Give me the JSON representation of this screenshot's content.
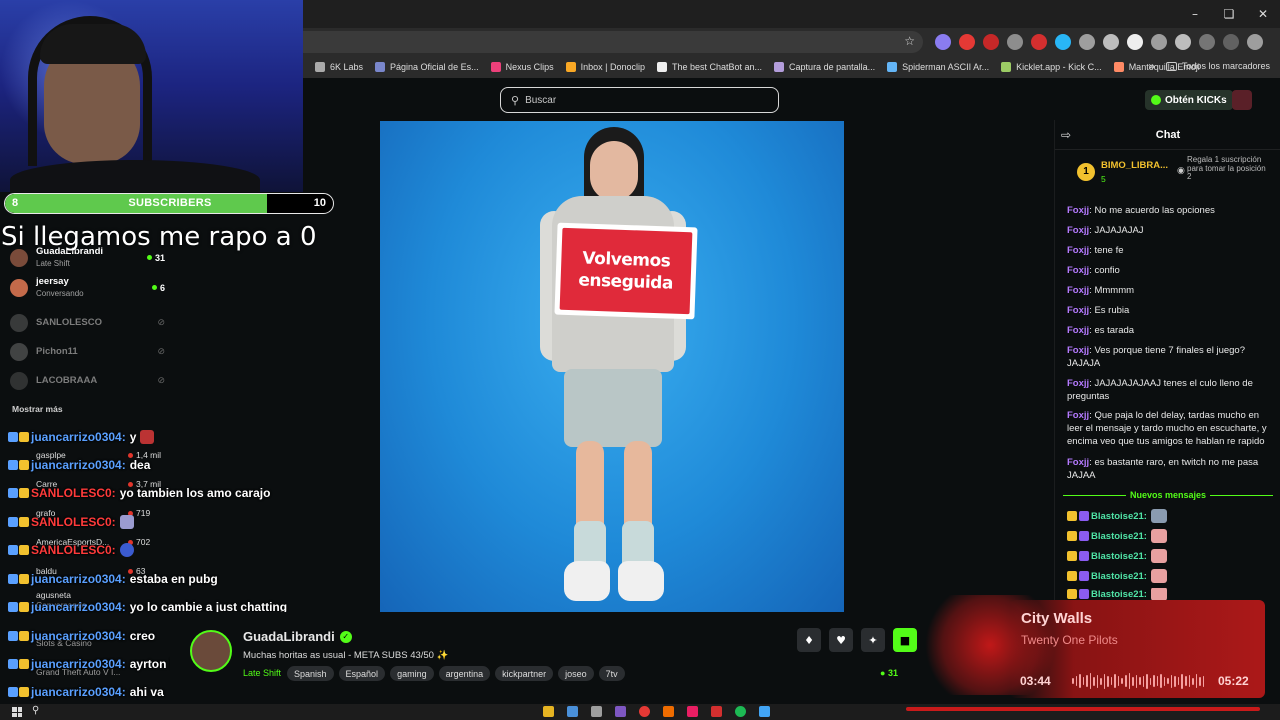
{
  "bookmarks": {
    "items": [
      "6K Labs",
      "Página Oficial de Es...",
      "Nexus Clips",
      "Inbox | Donoclip",
      "The best ChatBot an...",
      "Captura de pantalla...",
      "Spiderman ASCII Ar...",
      "Kicklet.app - Kick C...",
      "Mantequilla Emoji"
    ],
    "all_label": "Todos los marcadores"
  },
  "header": {
    "search_placeholder": "Buscar",
    "get_kicks_label": "Obtén KICKs"
  },
  "overlay": {
    "goal_current": "8",
    "goal_label": "SUBSCRIBERS",
    "goal_target": "10",
    "goal_progress": 0.8,
    "caption": "Si llegamos me rapo a 0"
  },
  "sidebar": {
    "following": [
      {
        "name": "GuadaLibrandi",
        "sub": "Late Shift",
        "count": "31",
        "live": true,
        "color": "#7a4b3a"
      },
      {
        "name": "jeersay",
        "sub": "Conversando",
        "count": "6",
        "live": true,
        "color": "#c46a4a"
      },
      {
        "name": "SANLOLESCO",
        "sub": "",
        "count": "",
        "live": false,
        "color": "#666"
      },
      {
        "name": "Pichon11",
        "sub": "",
        "count": "",
        "live": false,
        "color": "#777"
      },
      {
        "name": "LACOBRAAA",
        "sub": "",
        "count": "",
        "live": false,
        "color": "#555"
      }
    ],
    "show_more": "Mostrar más"
  },
  "recommended": [
    {
      "name": "gasplpe",
      "viewers": "1,4 mil"
    },
    {
      "name": "Carre",
      "viewers": "3,7 mil"
    },
    {
      "name": "grafo",
      "viewers": "719"
    },
    {
      "name": "AmericaEsportsD...",
      "viewers": "702"
    },
    {
      "name": "baldu",
      "viewers": "63"
    },
    {
      "name": "agusneta",
      "sub": "Conversando",
      "viewers": ""
    },
    {
      "name": "",
      "sub": "Slots & Casino",
      "viewers": ""
    },
    {
      "name": "",
      "sub": "Grand Theft Auto V I...",
      "viewers": ""
    }
  ],
  "overlay_chat": [
    {
      "user": "juancarrizo0304:",
      "msg": "y",
      "color": "#5aa0ff",
      "emote": true
    },
    {
      "user": "juancarrizo0304:",
      "msg": "dea",
      "color": "#5aa0ff",
      "emote": false
    },
    {
      "user": "SANLOLESC0:",
      "msg": "yo tambien los amo carajo",
      "color": "#ff3b3b",
      "emote": false
    },
    {
      "user": "SANLOLESC0:",
      "msg": "",
      "color": "#ff3b3b",
      "emote": true
    },
    {
      "user": "SANLOLESC0:",
      "msg": "",
      "color": "#ff3b3b",
      "emote": true
    },
    {
      "user": "juancarrizo0304:",
      "msg": "estaba en pubg",
      "color": "#5aa0ff",
      "emote": false
    },
    {
      "user": "juancarrizo0304:",
      "msg": "yo lo cambie a just chatting",
      "color": "#5aa0ff",
      "emote": false
    },
    {
      "user": "juancarrizo0304:",
      "msg": "creo",
      "color": "#5aa0ff",
      "emote": false
    },
    {
      "user": "juancarrizo0304:",
      "msg": "ayrton lo cambio a pubg",
      "color": "#5aa0ff",
      "emote": false
    },
    {
      "user": "juancarrizo0304:",
      "msg": "ahi va",
      "color": "#5aa0ff",
      "emote": false
    }
  ],
  "video": {
    "sign_line1": "Volvemos",
    "sign_line2": "enseguida"
  },
  "stream": {
    "name": "GuadaLibrandi",
    "title": "Muchas horitas as usual - META SUBS 43/50 ✨",
    "category": "Late Shift",
    "tags": [
      "Spanish",
      "Español",
      "gaming",
      "argentina",
      "kickpartner",
      "joseo",
      "7tv"
    ],
    "viewers": "31"
  },
  "chat": {
    "title": "Chat",
    "pinned_user": "BIMO_LIBRA...",
    "pinned_rank": "1",
    "pinned_count": "5",
    "pinned_desc": "Regala 1 suscripción para tomar la posición 2",
    "messages": [
      {
        "user": "Foxjj",
        "text": "No me acuerdo las opciones"
      },
      {
        "user": "Foxjj",
        "text": "JAJAJAJAJ"
      },
      {
        "user": "Foxjj",
        "text": "tene fe"
      },
      {
        "user": "Foxjj",
        "text": "confio"
      },
      {
        "user": "Foxjj",
        "text": "Mmmmm"
      },
      {
        "user": "Foxjj",
        "text": "Es rubia"
      },
      {
        "user": "Foxjj",
        "text": "es tarada"
      },
      {
        "user": "Foxjj",
        "text": "Ves porque tiene 7 finales el juego? JAJAJA"
      },
      {
        "user": "Foxjj",
        "text": "JAJAJAJAJAAJ tenes el culo lleno de preguntas"
      },
      {
        "user": "Foxjj",
        "text": "Que paja lo del delay, tardas mucho en leer el mensaje y tardo mucho en escucharte, y encima veo que tus amigos te hablan re rapido"
      },
      {
        "user": "Foxjj",
        "text": "es bastante raro, en twitch no me pasa JAJAA"
      }
    ],
    "new_messages_label": "Nuevos mensajes",
    "new_messages": [
      {
        "user": "Blastoise21:"
      },
      {
        "user": "Blastoise21:"
      },
      {
        "user": "Blastoise21:"
      },
      {
        "user": "Blastoise21:"
      },
      {
        "user": "Blastoise21:"
      }
    ]
  },
  "now_playing": {
    "song": "City Walls",
    "artist": "Twenty One Pilots",
    "elapsed": "03:44",
    "duration": "05:22"
  },
  "colors": {
    "kick_green": "#53fc18",
    "chat_user": "#b57aff",
    "gift_user": "#50e4a7"
  }
}
